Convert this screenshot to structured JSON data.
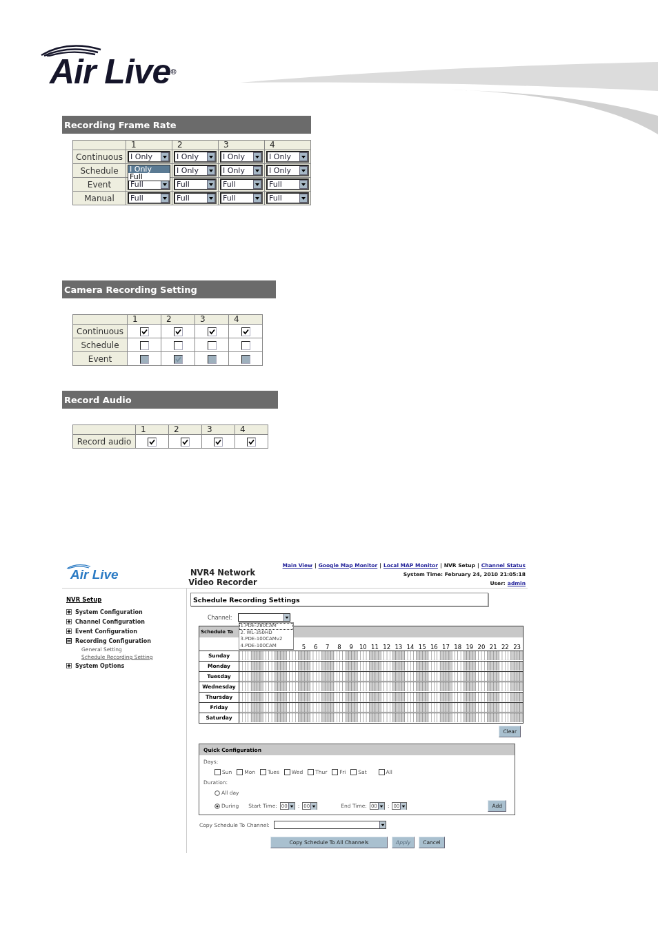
{
  "logo": {
    "text": "Air Live$^{®}$"
  },
  "frame_rate": {
    "title": "Recording Frame Rate",
    "columns": [
      "1",
      "2",
      "3",
      "4"
    ],
    "rows": [
      {
        "label": "Continuous",
        "cells": [
          {
            "value": "I Only",
            "expanded": false
          },
          {
            "value": "I Only",
            "expanded": false
          },
          {
            "value": "I Only",
            "expanded": false
          },
          {
            "value": "I Only",
            "expanded": false
          }
        ]
      },
      {
        "label": "Schedule",
        "cells": [
          {
            "expanded": true,
            "options": [
              {
                "label": "I Only",
                "selected": true
              },
              {
                "label": "Full",
                "selected": false
              }
            ]
          },
          {
            "value": "I Only",
            "expanded": false
          },
          {
            "value": "I Only",
            "expanded": false
          },
          {
            "value": "I Only",
            "expanded": false
          }
        ]
      },
      {
        "label": "Event",
        "cells": [
          {
            "value": "Full",
            "expanded": false
          },
          {
            "value": "Full",
            "expanded": false
          },
          {
            "value": "Full",
            "expanded": false
          },
          {
            "value": "Full",
            "expanded": false
          }
        ]
      },
      {
        "label": "Manual",
        "cells": [
          {
            "value": "Full",
            "expanded": false
          },
          {
            "value": "Full",
            "expanded": false
          },
          {
            "value": "Full",
            "expanded": false
          },
          {
            "value": "Full",
            "expanded": false
          }
        ]
      }
    ]
  },
  "camera_recording": {
    "title": "Camera Recording Setting",
    "columns": [
      "1",
      "2",
      "3",
      "4"
    ],
    "rows": [
      {
        "label": "Continuous",
        "disabled": false,
        "cells": [
          {
            "checked": true
          },
          {
            "checked": true
          },
          {
            "checked": true
          },
          {
            "checked": true
          }
        ]
      },
      {
        "label": "Schedule",
        "disabled": false,
        "cells": [
          {
            "checked": false
          },
          {
            "checked": false
          },
          {
            "checked": false
          },
          {
            "checked": false
          }
        ]
      },
      {
        "label": "Event",
        "disabled": true,
        "cells": [
          {
            "checked": false
          },
          {
            "checked": true
          },
          {
            "checked": false
          },
          {
            "checked": false
          }
        ]
      }
    ]
  },
  "record_audio": {
    "title": "Record Audio",
    "columns": [
      "1",
      "2",
      "3",
      "4"
    ],
    "rows": [
      {
        "label": "Record audio",
        "disabled": false,
        "cells": [
          {
            "checked": true
          },
          {
            "checked": true
          },
          {
            "checked": true
          },
          {
            "checked": true
          }
        ]
      }
    ]
  },
  "nvr": {
    "logo": "Air Live",
    "title": "NVR4 Network Video Recorder",
    "nav": [
      {
        "label": "Main View",
        "selected": false
      },
      {
        "label": "Google Map Monitor",
        "separator": "|",
        "selected": false
      },
      {
        "label": "Local MAP Monitor",
        "separator": "|",
        "selected": false
      },
      {
        "label": "NVR Setup",
        "separator": "|",
        "selected": true
      },
      {
        "label": "Channel Status",
        "separator": "|",
        "selected": false
      }
    ],
    "system_time": "System Time: February 24, 2010 21:05:18",
    "user_label": "User:",
    "user": "admin",
    "sidebar": {
      "heading": "NVR Setup",
      "items": [
        {
          "label": "System Configuration",
          "expanded": false
        },
        {
          "label": "Channel Configuration",
          "expanded": false
        },
        {
          "label": "Event Configuration",
          "expanded": false
        },
        {
          "label": "Recording Configuration",
          "expanded": true,
          "children": [
            {
              "label": "General Setting",
              "selected": false
            },
            {
              "label": "Schedule Recording Setting",
              "selected": true
            }
          ]
        },
        {
          "label": "System Options",
          "expanded": false
        }
      ]
    },
    "panel_title": "Schedule Recording Settings",
    "channel": {
      "label": "Channel:",
      "expanded": true,
      "options": [
        {
          "label": "1.PDE-280CAM",
          "selected": true
        },
        {
          "label": "2. WL-350HD",
          "selected": false
        },
        {
          "label": "3.PDE-100CAMv2",
          "selected": false
        },
        {
          "label": "4.PDE-100CAM",
          "selected": false
        }
      ]
    },
    "schedule": {
      "title": "Schedule Ta",
      "hours": [
        "5",
        "6",
        "7",
        "8",
        "9",
        "10",
        "11",
        "12",
        "13",
        "14",
        "15",
        "16",
        "17",
        "18",
        "19",
        "20",
        "21",
        "22",
        "23"
      ],
      "days": [
        "Sunday",
        "Monday",
        "Tuesday",
        "Wednesday",
        "Thursday",
        "Friday",
        "Saturday"
      ]
    },
    "clear_button": "Clear",
    "quick": {
      "title": "Quick Configuration",
      "days_label": "Days:",
      "days": [
        {
          "label": "Sun",
          "checked": false
        },
        {
          "label": "Mon",
          "checked": false
        },
        {
          "label": "Tues",
          "checked": false
        },
        {
          "label": "Wed",
          "checked": false
        },
        {
          "label": "Thur",
          "checked": false
        },
        {
          "label": "Fri",
          "checked": false
        },
        {
          "label": "Sat",
          "checked": false
        },
        {
          "label": "All",
          "checked": false
        }
      ],
      "duration_label": "Duration:",
      "durations": [
        {
          "label": "All day",
          "selected": false
        },
        {
          "label": "During",
          "selected": true
        }
      ],
      "start_label": "Start Time:",
      "start": {
        "hour": "00",
        "separator": ":",
        "minute": "00"
      },
      "end_label": "End Time:",
      "end": {
        "hour": "00",
        "separator": ":",
        "minute": "00"
      },
      "add_button": "Add"
    },
    "copy_label": "Copy Schedule To Channel:",
    "buttons": [
      {
        "label": "Copy Schedule To All Channels",
        "disabled": false
      },
      {
        "label": "Apply",
        "disabled": true
      },
      {
        "label": "Cancel",
        "disabled": false
      }
    ]
  }
}
